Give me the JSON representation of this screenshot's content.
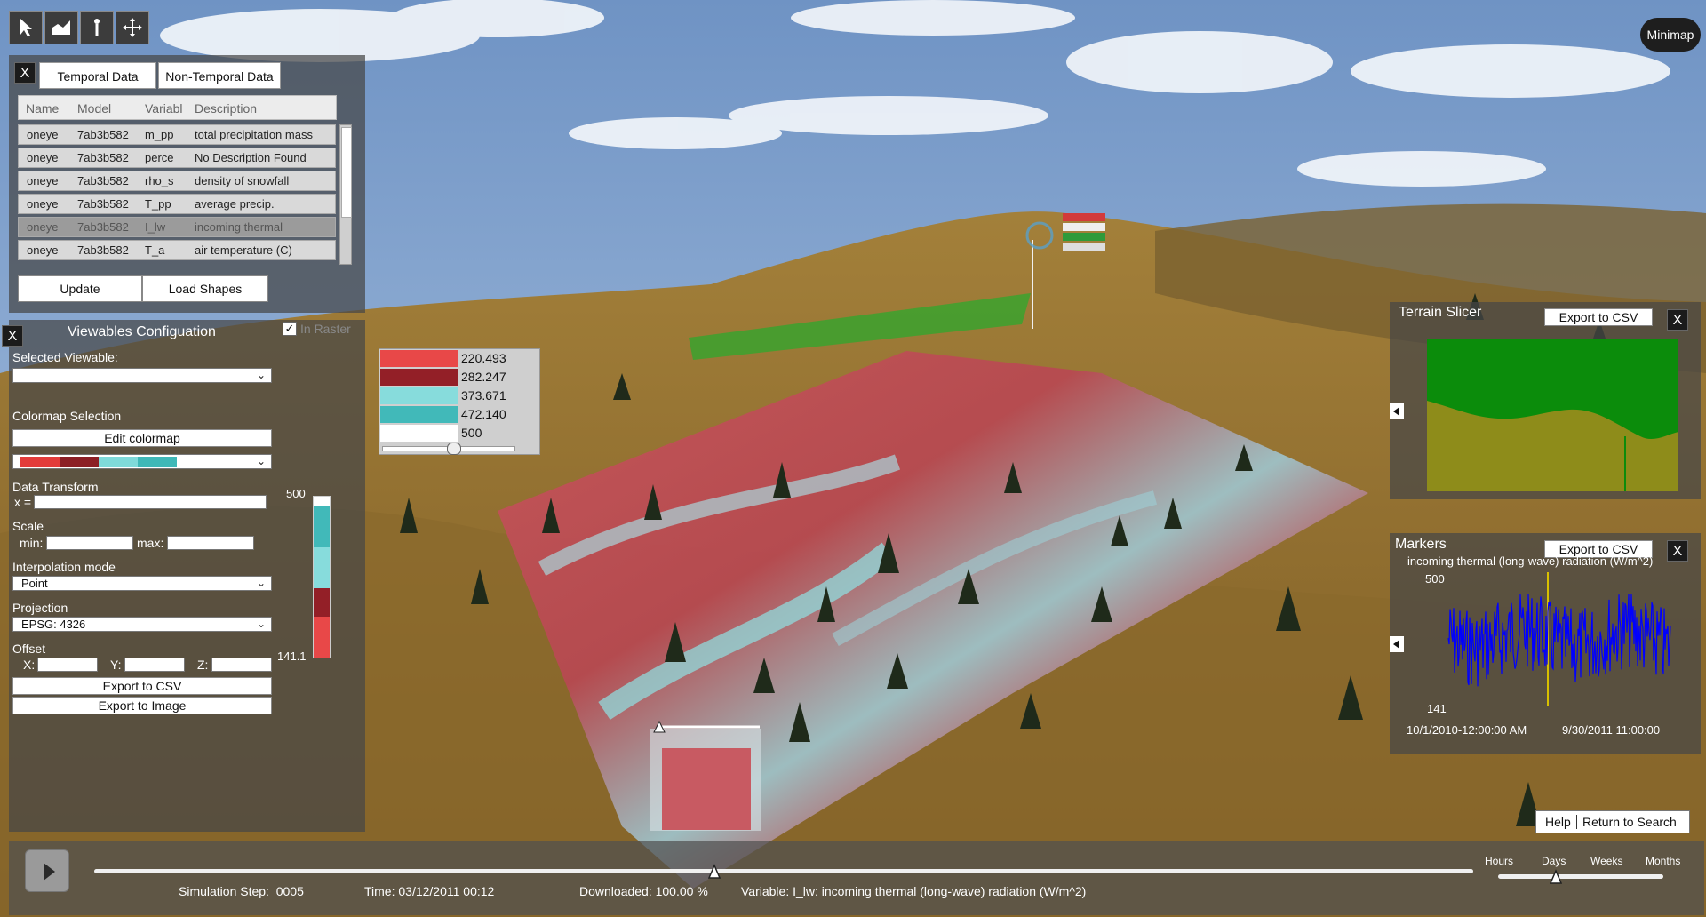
{
  "toolbar": {
    "tools": [
      {
        "icon": "pointer-icon"
      },
      {
        "icon": "terrain-slice-icon"
      },
      {
        "icon": "marker-pin-icon"
      },
      {
        "icon": "move-icon"
      }
    ]
  },
  "minimap_label": "Minimap",
  "data_panel": {
    "close": "X",
    "tabs": [
      "Temporal Data",
      "Non-Temporal Data"
    ],
    "columns": [
      "Name",
      "Model",
      "Variabl",
      "Description"
    ],
    "rows": [
      {
        "name": "oneye",
        "model": "7ab3b582",
        "variable": "m_pp",
        "description": "total precipitation mass"
      },
      {
        "name": "oneye",
        "model": "7ab3b582",
        "variable": "perce",
        "description": "No Description Found"
      },
      {
        "name": "oneye",
        "model": "7ab3b582",
        "variable": "rho_s",
        "description": "density of snowfall"
      },
      {
        "name": "oneye",
        "model": "7ab3b582",
        "variable": "T_pp",
        "description": "average precip."
      },
      {
        "name": "oneye",
        "model": "7ab3b582",
        "variable": "I_lw",
        "description": "incoming thermal"
      },
      {
        "name": "oneye",
        "model": "7ab3b582",
        "variable": "T_a",
        "description": "air temperature (C)"
      }
    ],
    "update_label": "Update",
    "load_shapes_label": "Load Shapes"
  },
  "viewables": {
    "close": "X",
    "title": "Viewables Configuation",
    "checkbox_label": "In Raster",
    "selected_viewable_label": "Selected Viewable:",
    "selected_viewable_value": "",
    "colormap_selection_label": "Colormap Selection",
    "edit_colormap_label": "Edit colormap",
    "colormap_colors": [
      "#e23b3b",
      "#8c1f26",
      "#7fdada",
      "#3fb8b8",
      "#ffffff"
    ],
    "data_transform_label": "Data Transform",
    "x_eq": "x =",
    "scale_label": "Scale",
    "min_label": "min:",
    "max_label": "max:",
    "interpolation_label": "Interpolation mode",
    "interpolation_value": "Point",
    "projection_label": "Projection",
    "projection_value": "EPSG: 4326",
    "offset_label": "Offset",
    "offset_x": "X:",
    "offset_y": "Y:",
    "offset_z": "Z:",
    "export_csv_label": "Export to CSV",
    "export_image_label": "Export to Image",
    "colorbar_max": "500",
    "colorbar_min": "141.1"
  },
  "legend": {
    "entries": [
      {
        "color": "#e84848",
        "value": "220.493"
      },
      {
        "color": "#931f27",
        "value": "282.247"
      },
      {
        "color": "#87dcdc",
        "value": "373.671"
      },
      {
        "color": "#41b9b9",
        "value": "472.140"
      },
      {
        "color": "#ffffff",
        "value": "500"
      }
    ],
    "slider_value": 0.4
  },
  "terrain_slicer": {
    "title": "Terrain Slicer",
    "export_label": "Export to CSV",
    "close": "X"
  },
  "markers": {
    "title": "Markers",
    "export_label": "Export to CSV",
    "close": "X",
    "series_title": "incoming thermal (long-wave) radiation (W/m^2)",
    "y_max": "500",
    "y_min": "141",
    "x_start": "10/1/2010-12:00:00 AM",
    "x_end": "9/30/2011 11:00:00"
  },
  "help_bar": {
    "help_label": "Help",
    "return_label": "Return to Search"
  },
  "timeline": {
    "play_icon": "play-icon",
    "progress_fraction": 0.45,
    "simulation_step": "Simulation Step:  0005",
    "time": "Time: 03/12/2011 00:12",
    "downloaded": "Downloaded: 100.00 %",
    "variable": "Variable: I_lw: incoming thermal (long-wave) radiation (W/m^2)",
    "scale_options": [
      "Hours",
      "Days",
      "Weeks",
      "Months"
    ],
    "scale_selected": "Days"
  },
  "colors": {
    "panel_bg": "#474747",
    "sky": "#8aa7c8",
    "hill": "#9b7a35",
    "accent_green": "#0a8a0a",
    "series_blue": "#0000ff"
  }
}
